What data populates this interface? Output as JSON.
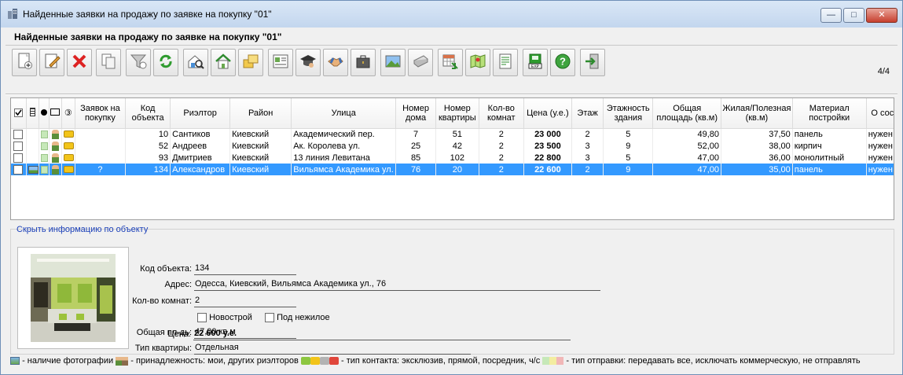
{
  "window": {
    "title": "Найденные заявки на продажу по заявке на покупку \"01\""
  },
  "heading": "Найденные заявки на продажу по заявке на покупку \"01\"",
  "counter": "4/4",
  "toolbar": [
    {
      "name": "new-document-button",
      "icon": "new-document-icon"
    },
    {
      "name": "edit-button",
      "icon": "edit-icon"
    },
    {
      "name": "delete-button",
      "icon": "delete-icon"
    },
    {
      "name": "copy-button",
      "icon": "copy-icon"
    },
    {
      "name": "filter-button",
      "icon": "filter-icon"
    },
    {
      "name": "refresh-button",
      "icon": "refresh-icon"
    },
    {
      "name": "search-house-button",
      "icon": "search-house-icon"
    },
    {
      "name": "house-button",
      "icon": "house-icon"
    },
    {
      "name": "folders-button",
      "icon": "folders-icon"
    },
    {
      "name": "card-button",
      "icon": "card-icon"
    },
    {
      "name": "graduation-button",
      "icon": "graduation-icon"
    },
    {
      "name": "handshake-button",
      "icon": "handshake-icon"
    },
    {
      "name": "case-button",
      "icon": "case-icon"
    },
    {
      "name": "picture-button",
      "icon": "picture-icon"
    },
    {
      "name": "print-button",
      "icon": "print-icon"
    },
    {
      "name": "table-button",
      "icon": "table-icon"
    },
    {
      "name": "map-button",
      "icon": "map-icon"
    },
    {
      "name": "report-button",
      "icon": "report-icon"
    },
    {
      "name": "export-button",
      "icon": "export-icon"
    },
    {
      "name": "help-button",
      "icon": "help-icon"
    },
    {
      "name": "exit-button",
      "icon": "exit-icon"
    }
  ],
  "table": {
    "columns": [
      "Заявок на покупку",
      "Код объекта",
      "Риэлтор",
      "Район",
      "Улица",
      "Номер дома",
      "Номер квартиры",
      "Кол-во комнат",
      "Цена (у.е.)",
      "Этаж",
      "Этажность здания",
      "Общая площадь (кв.м)",
      "Жилая/Полезная (кв.м)",
      "Материал постройки",
      "О сос"
    ],
    "rows": [
      {
        "zayavok": "",
        "kod": "10",
        "rieltor": "Сантиков",
        "rayon": "Киевский",
        "ulica": "Академический пер.",
        "dom": "7",
        "kv": "51",
        "komnat": "2",
        "cena": "23 000",
        "etazh": "2",
        "etazhnost": "5",
        "obsh": "49,80",
        "zhil": "37,50",
        "material": "панель",
        "sost": "нужен",
        "photo": false,
        "selected": false
      },
      {
        "zayavok": "",
        "kod": "52",
        "rieltor": "Андреев",
        "rayon": "Киевский",
        "ulica": "Ак. Королева ул.",
        "dom": "25",
        "kv": "42",
        "komnat": "2",
        "cena": "23 500",
        "etazh": "3",
        "etazhnost": "9",
        "obsh": "52,00",
        "zhil": "38,00",
        "material": "кирпич",
        "sost": "нужен",
        "photo": false,
        "selected": false
      },
      {
        "zayavok": "",
        "kod": "93",
        "rieltor": "Дмитриев",
        "rayon": "Киевский",
        "ulica": "13 линия Левитана",
        "dom": "85",
        "kv": "102",
        "komnat": "2",
        "cena": "22 800",
        "etazh": "3",
        "etazhnost": "5",
        "obsh": "47,00",
        "zhil": "36,00",
        "material": "монолитный",
        "sost": "нужен",
        "photo": false,
        "selected": false
      },
      {
        "zayavok": "?",
        "kod": "134",
        "rieltor": "Александров",
        "rayon": "Киевский",
        "ulica": "Вильямса Академика ул.",
        "dom": "76",
        "kv": "20",
        "komnat": "2",
        "cena": "22 600",
        "etazh": "2",
        "etazhnost": "9",
        "obsh": "47,00",
        "zhil": "35,00",
        "material": "панель",
        "sost": "нужен",
        "photo": true,
        "selected": true
      }
    ]
  },
  "info": {
    "toggle_link": "Скрыть информацию по объекту",
    "labels": {
      "kod": "Код объекта:",
      "adres": "Адрес:",
      "komnat": "Кол-во комнат:",
      "area": "Общая пл-дь:",
      "tip": "Тип квартиры:",
      "cena": "Цена:"
    },
    "values": {
      "kod": "134",
      "adres": "Одесса, Киевский, Вильямса Академика ул., 76",
      "komnat": "2",
      "area": "47,00 кв.м",
      "tip": "Отдельная",
      "cena": "22 600 у.е."
    },
    "checkboxes": {
      "novostroy": "Новострой",
      "nezhiloe": "Под нежилое"
    }
  },
  "legend": {
    "photo": "- наличие фотографии",
    "owner": "- принадлежность: мои, других риэлторов",
    "contact": "- тип контакта: эксклюзив, прямой, посредник, ч/с",
    "send": "- тип отправки: передавать все, исключать коммерческую, не отправлять"
  },
  "colors": {
    "selection": "#3399ff",
    "link": "#1a3fb8",
    "close_button": "#c73f2e"
  }
}
